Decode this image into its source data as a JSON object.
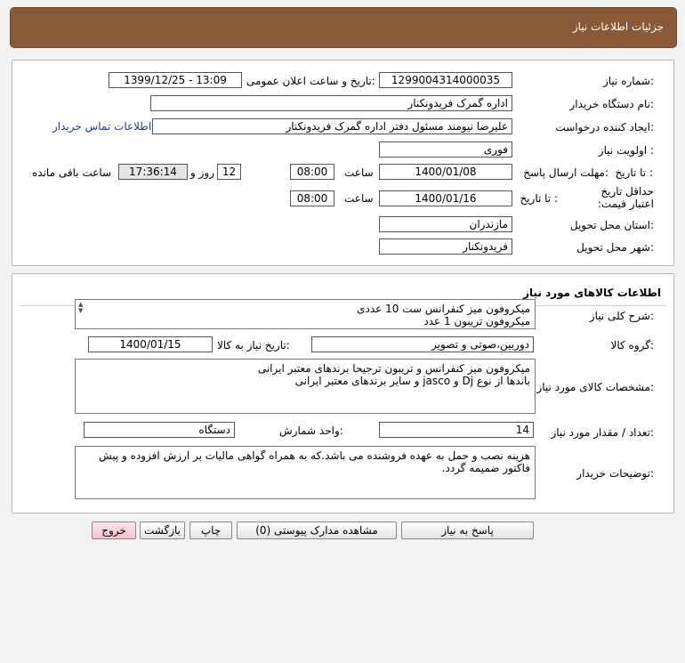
{
  "header": {
    "title": "جزئیات اطلاعات نیاز"
  },
  "info": {
    "need_number_label": "شماره نیاز:",
    "need_number": "1299004314000035",
    "announce_label": "تاریخ و ساعت اعلان عمومی:",
    "announce_value": "1399/12/25 - 13:09",
    "buyer_org_label": "نام دستگاه خریدار:",
    "buyer_org": "اداره گمرک فریدونکنار",
    "requester_label": "ایجاد کننده درخواست:",
    "requester": "علیرضا نیومند مسئول دفتر اداره گمرک فریدونکنار",
    "contact_link": "اطلاعات تماس خریدار",
    "priority_label": "اولویت نیاز :",
    "priority": "فوری",
    "deadline_label": "مهلت ارسال پاسخ:",
    "to_date_label": "تا تاریخ :",
    "deadline_date": "1400/01/08",
    "time_label": "ساعت",
    "deadline_time": "08:00",
    "days_value": "12",
    "days_label": "روز و",
    "remaining_time": "17:36:14",
    "remaining_label": "ساعت باقی مانده",
    "validity_label": "حداقل تاریخ اعتبار قیمت:",
    "validity_to_label": "تا تاریخ :",
    "validity_date": "1400/01/16",
    "validity_time_label": "ساعت",
    "validity_time": "08:00",
    "province_label": "استان محل تحویل:",
    "province": "مازندران",
    "city_label": "شهر محل تحویل:",
    "city": "فریدونکنار"
  },
  "goods": {
    "section_title": "اطلاعات کالاهای مورد نیاز",
    "desc_label": "شرح کلی نیاز:",
    "desc_line1": "میکروفون میز کنفرانس ست 10 عددی",
    "desc_line2": "میکروفون تریبون 1 عدد",
    "group_label": "گروه کالا:",
    "group_value": "دوربین،صوتی و تصویر",
    "need_date_label": "تاریخ نیاز به کالا:",
    "need_date": "1400/01/15",
    "spec_label": "مشخصات کالای مورد نیاز:",
    "spec_line1": "میکروفون میز کنفرانس و تریبون ترجیحا برندهای معتبر ایرانی",
    "spec_line2": "باندها از نوع Dj و jasco و سایر برندهای معتبر ایرانی",
    "qty_label": "تعداد / مقدار مورد نیاز:",
    "qty": "14",
    "unit_label": "واحد شمارش:",
    "unit": "دستگاه",
    "notes_label": "توضیحات خریدار:",
    "notes": "هزینه نصب و حمل به عهده فروشنده می باشد.که به همراه گواهی مالیات بر ارزش افزوده و پیش فاکتور ضمیمه گردد."
  },
  "buttons": {
    "reply": "پاسخ به نیاز",
    "attachments": "مشاهده مدارک پیوستی (0)",
    "print": "چاپ",
    "back": "بازگشت",
    "exit": "خروج"
  }
}
